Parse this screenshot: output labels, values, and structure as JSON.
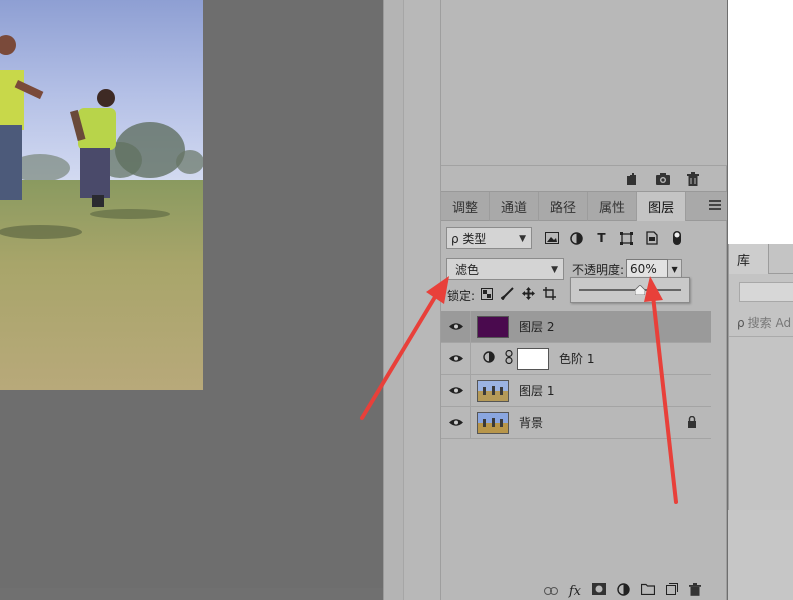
{
  "panel_tabs": [
    {
      "label": "调整"
    },
    {
      "label": "通道"
    },
    {
      "label": "路径"
    },
    {
      "label": "属性"
    },
    {
      "label": "图层"
    }
  ],
  "filter": {
    "kind_label": "ρ 类型"
  },
  "blend": {
    "mode": "滤色",
    "opacity_label": "不透明度:",
    "opacity_value": "60%",
    "opacity_slider_fraction": 0.6
  },
  "lock": {
    "label": "锁定:"
  },
  "layers": [
    {
      "name": "图层 2",
      "selected": true,
      "thumb_color": "#4a0a4e"
    },
    {
      "name": "色阶 1"
    },
    {
      "name": "图层 1"
    },
    {
      "name": "背景",
      "locked": true
    }
  ],
  "library": {
    "tab_label": "库",
    "search_placeholder": "搜索 Ad"
  },
  "colors": {
    "canvas_bg": "#6e6e6e",
    "panel_bg": "#b8b8b8",
    "selected_layer_bg": "#9a9a9a",
    "arrow": "#e8403a"
  }
}
